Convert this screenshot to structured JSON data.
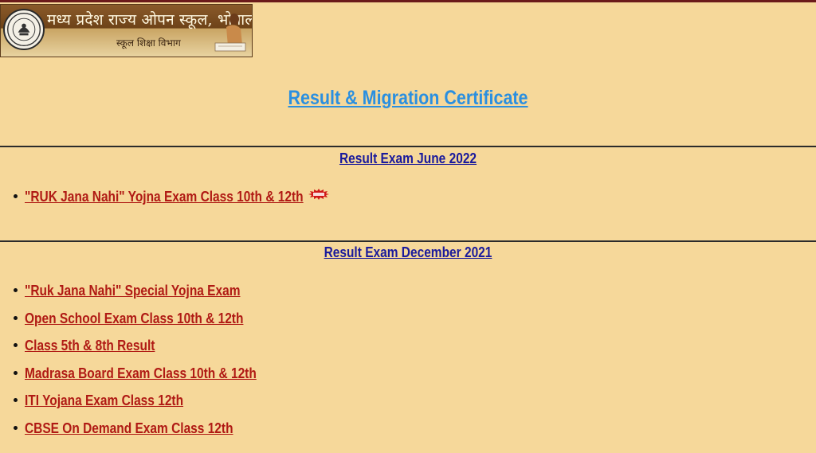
{
  "banner": {
    "title": "मध्य प्रदेश राज्य ओपन स्कूल, भोपाल",
    "subtitle": "स्कूल शिक्षा विभाग"
  },
  "page_title": "Result & Migration Certificate",
  "sections": [
    {
      "heading": "Result Exam June 2022",
      "links": [
        {
          "label": "\"RUK Jana Nahi\" Yojna Exam Class 10th & 12th",
          "badge": "new-badge-icon"
        }
      ]
    },
    {
      "heading": "Result Exam December 2021",
      "links": [
        {
          "label": "\"Ruk Jana Nahi\" Special Yojna Exam"
        },
        {
          "label": "Open School Exam Class 10th & 12th"
        },
        {
          "label": "Class 5th & 8th Result"
        },
        {
          "label": "Madrasa Board Exam Class 10th & 12th"
        },
        {
          "label": "ITI Yojana Exam Class 12th"
        },
        {
          "label": "CBSE On Demand Exam Class 12th"
        }
      ]
    }
  ],
  "colors": {
    "background": "#f6d89a",
    "title": "#2a8fe0",
    "heading": "#1a1a9c",
    "link": "#b01a14"
  }
}
